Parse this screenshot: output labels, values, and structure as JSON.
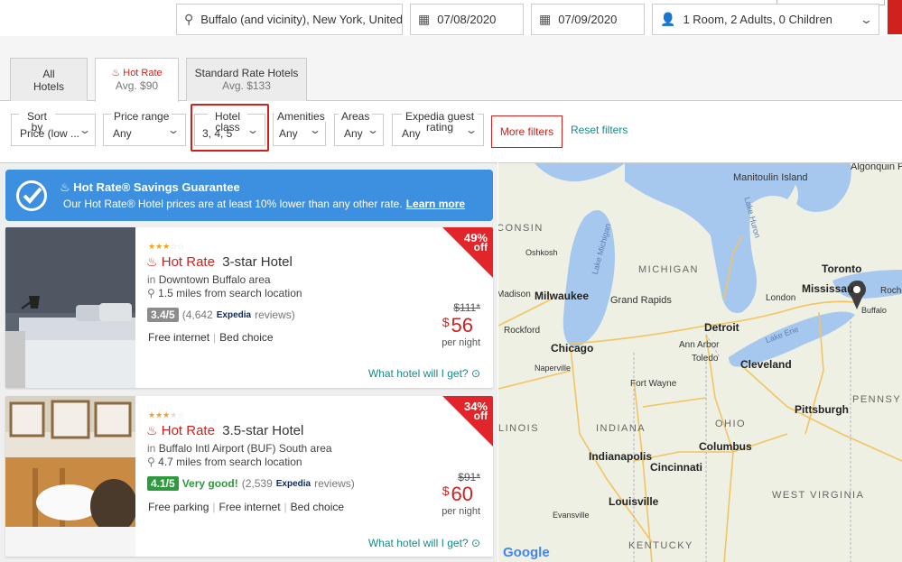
{
  "search": {
    "location": "Buffalo (and vicinity), New York, United...",
    "check_in": "07/08/2020",
    "check_out": "07/09/2020",
    "guests": "1 Room, 2 Adults, 0 Children"
  },
  "tabs": [
    {
      "label": "All Hotels",
      "sub": ""
    },
    {
      "label": "Hot Rate",
      "sub": "Avg. $90"
    },
    {
      "label": "Standard Rate Hotels",
      "sub": "Avg. $133"
    }
  ],
  "filters": {
    "sort": {
      "label": "Sort by",
      "value": "Price (low ..."
    },
    "price": {
      "label": "Price range",
      "value": "Any"
    },
    "hotel_class": {
      "label": "Hotel class",
      "value": "3, 4, 5"
    },
    "amenities": {
      "label": "Amenities",
      "value": "Any"
    },
    "areas": {
      "label": "Areas",
      "value": "Any"
    },
    "guest_rating": {
      "label": "Expedia guest rating",
      "value": "Any"
    },
    "more": "More filters",
    "reset": "Reset filters"
  },
  "banner": {
    "title": "Hot Rate® Savings Guarantee",
    "desc": "Our Hot Rate® Hotel prices are at least 10% lower than any other rate.",
    "link": "Learn more"
  },
  "hotels": [
    {
      "stars": "★★★",
      "stars_off": "☆☆",
      "hot_rate": "Hot Rate",
      "name": "3-star Hotel",
      "area_prefix": "in",
      "area": "Downtown Buffalo area",
      "distance": "1.5 miles from search location",
      "score": "3.4/5",
      "score_word": "",
      "reviews_pre": "(4,642",
      "reviews_post": "reviews)",
      "amenities": [
        "Free internet",
        "Bed choice"
      ],
      "discount": "49%",
      "off": "off",
      "old_price": "$111*",
      "currency": "$",
      "price": "56",
      "per_night": "per night",
      "link": "What hotel will I get?"
    },
    {
      "stars": "★★★",
      "stars_off": "★☆",
      "hot_rate": "Hot Rate",
      "name": "3.5-star Hotel",
      "area_prefix": "in",
      "area": "Buffalo Intl Airport (BUF) South area",
      "distance": "4.7 miles from search location",
      "score": "4.1/5",
      "score_word": "Very good!",
      "reviews_pre": "(2,539",
      "reviews_post": "reviews)",
      "amenities": [
        "Free parking",
        "Free internet",
        "Bed choice"
      ],
      "discount": "34%",
      "off": "off",
      "old_price": "$91*",
      "currency": "$",
      "price": "60",
      "per_night": "per night",
      "link": "What hotel will I get?"
    }
  ],
  "expedia": "Expedia",
  "map": {
    "labels": {
      "algonquin": "Algonquin Provincial Park",
      "manitoulin": "Manitoulin Island",
      "lake_huron": "Lake Huron",
      "lake_michigan": "Lake Michigan",
      "lake_erie": "Lake Erie",
      "wisconsin": "CONSIN",
      "michigan": "MICHIGAN",
      "oshkosh": "Oshkosh",
      "madison": "Madison",
      "milwaukee": "Milwaukee",
      "grand_rapids": "Grand Rapids",
      "london": "London",
      "toronto": "Toronto",
      "mississauga": "Mississau",
      "rochester": "Roche",
      "buffalo": "Buffalo",
      "detroit": "Detroit",
      "ann_arbor": "Ann Arbor",
      "rockford": "Rockford",
      "chicago": "Chicago",
      "naperville": "Naperville",
      "toledo": "Toledo",
      "cleveland": "Cleveland",
      "fort_wayne": "Fort Wayne",
      "pittsburgh": "Pittsburgh",
      "pennsylvania": "PENNSYL",
      "illinois": "LINOIS",
      "indiana": "INDIANA",
      "ohio": "OHIO",
      "columbus": "Columbus",
      "indianapolis": "Indianapolis",
      "cincinnati": "Cincinnati",
      "west_virginia": "WEST VIRGINIA",
      "louisville": "Louisville",
      "evansville": "Evansville",
      "kentucky": "KENTUCKY",
      "google": "Google"
    }
  }
}
